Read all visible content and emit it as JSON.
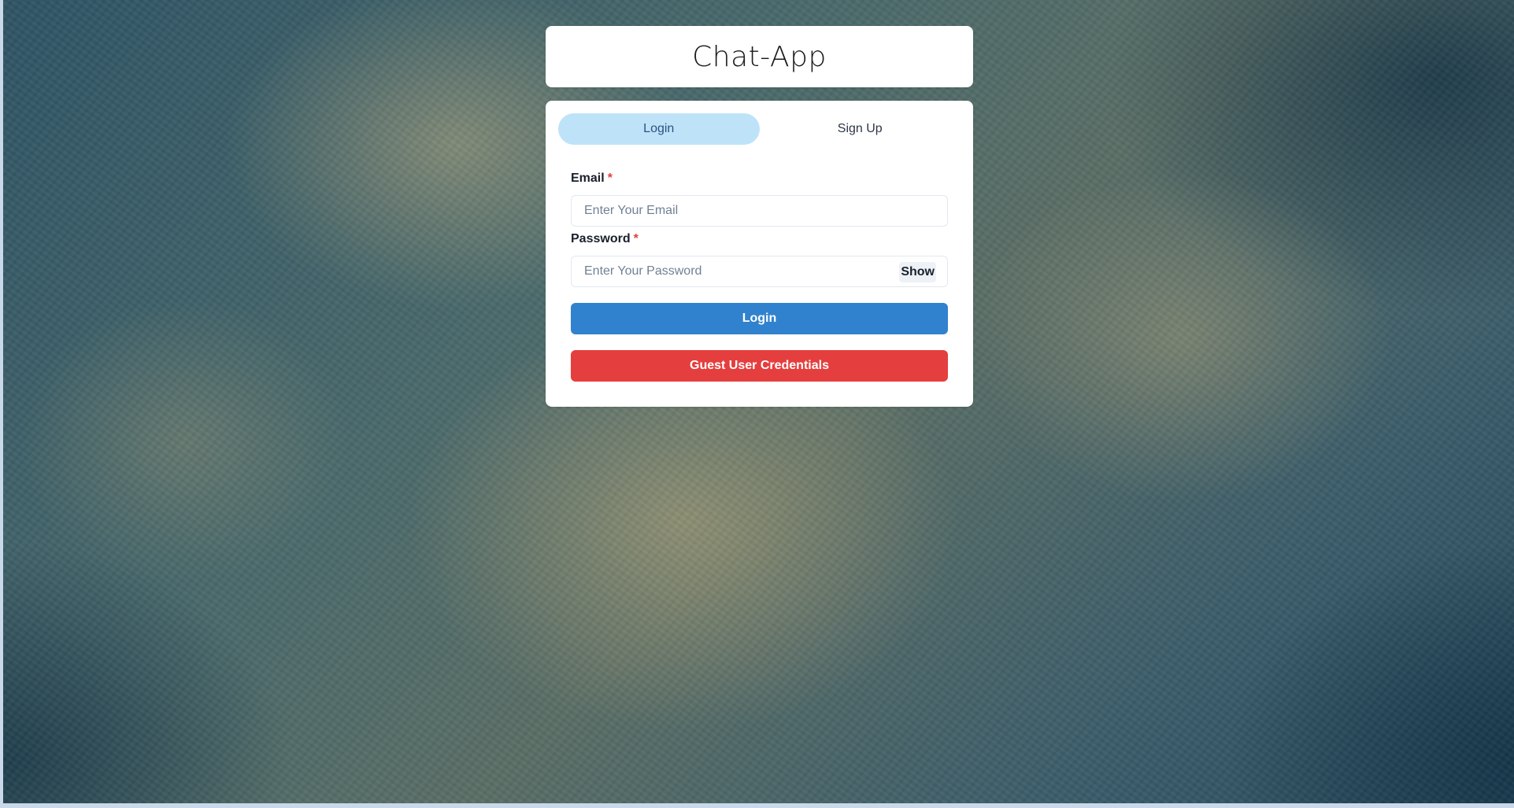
{
  "app": {
    "title": "Chat-App"
  },
  "tabs": [
    {
      "label": "Login",
      "active": true
    },
    {
      "label": "Sign Up",
      "active": false
    }
  ],
  "form": {
    "email_label": "Email",
    "email_placeholder": "Enter Your Email",
    "password_label": "Password",
    "password_placeholder": "Enter Your Password",
    "required_marker": "*",
    "show_label": "Show",
    "login_button": "Login",
    "guest_button": "Guest User Credentials"
  },
  "colors": {
    "active_tab_bg": "#bee3f8",
    "login_button": "#3182ce",
    "guest_button": "#e53e3e",
    "required": "#e53e3e"
  }
}
